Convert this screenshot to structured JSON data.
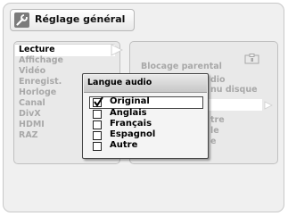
{
  "header": {
    "title": "Réglage général",
    "icon": "wrench-icon"
  },
  "menu": {
    "items": [
      "Lecture",
      "Affichage",
      "Vidéo",
      "Enregist.",
      "Horloge",
      "Canal",
      "DivX",
      "HDMI",
      "RAZ"
    ],
    "selected": "Lecture"
  },
  "submenu": {
    "visible_fragments": [
      "Blocage parental",
      "dio",
      "nu disque",
      "tre",
      "le",
      "e"
    ],
    "icons": [
      "parental-lock-icon"
    ]
  },
  "dialog": {
    "title": "Langue audio",
    "options": [
      "Original",
      "Anglais",
      "Français",
      "Espagnol",
      "Autre"
    ],
    "selected": "Original",
    "checked": "Original"
  },
  "colors": {
    "background": "#f0f0f0",
    "dim_text": "#a8a8a8",
    "active_text": "#000000",
    "highlight": "#ffffff"
  }
}
